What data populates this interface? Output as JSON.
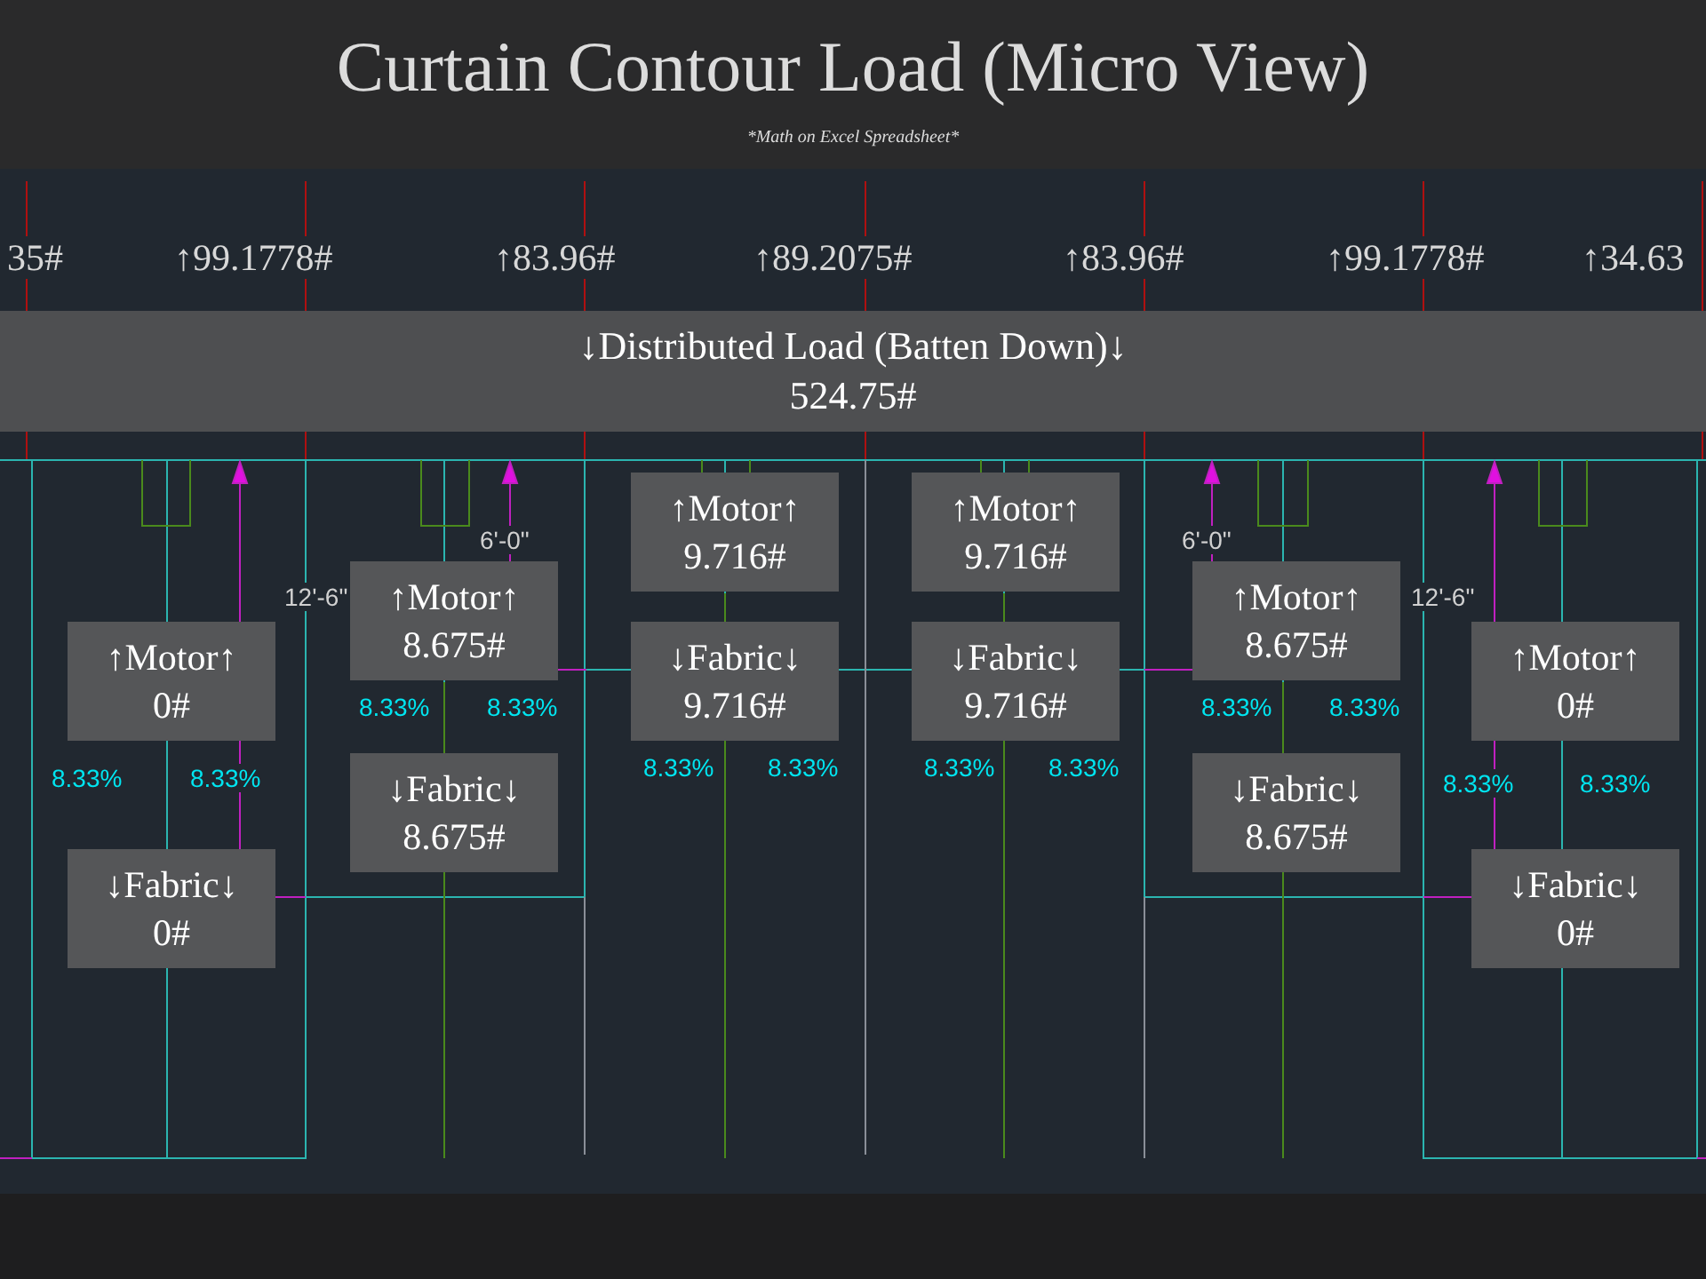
{
  "title": "Curtain Contour Load (Micro View)",
  "subtitle": "*Math on Excel Spreadsheet*",
  "top_loads": [
    "35#",
    "↑99.1778#",
    "↑83.96#",
    "↑89.2075#",
    "↑83.96#",
    "↑99.1778#",
    "↑34.63"
  ],
  "distributed_load": {
    "label": "↓Distributed Load (Batten Down)↓",
    "value": "524.75#"
  },
  "sections": [
    {
      "motor": {
        "label": "↑Motor↑",
        "value": "0#"
      },
      "fabric": {
        "label": "↓Fabric↓",
        "value": "0#"
      },
      "dimension": "12'-6\"",
      "percentages": [
        "8.33%",
        "8.33%"
      ]
    },
    {
      "motor": {
        "label": "↑Motor↑",
        "value": "8.675#"
      },
      "fabric": {
        "label": "↓Fabric↓",
        "value": "8.675#"
      },
      "dimension": "6'-0\"",
      "percentages": [
        "8.33%",
        "8.33%"
      ]
    },
    {
      "motor": {
        "label": "↑Motor↑",
        "value": "9.716#"
      },
      "fabric": {
        "label": "↓Fabric↓",
        "value": "9.716#"
      },
      "percentages": [
        "8.33%",
        "8.33%"
      ]
    },
    {
      "motor": {
        "label": "↑Motor↑",
        "value": "9.716#"
      },
      "fabric": {
        "label": "↓Fabric↓",
        "value": "9.716#"
      },
      "percentages": [
        "8.33%",
        "8.33%"
      ]
    },
    {
      "motor": {
        "label": "↑Motor↑",
        "value": "8.675#"
      },
      "fabric": {
        "label": "↓Fabric↓",
        "value": "8.675#"
      },
      "dimension": "6'-0\"",
      "percentages": [
        "8.33%",
        "8.33%"
      ]
    },
    {
      "motor": {
        "label": "↑Motor↑",
        "value": "0#"
      },
      "fabric": {
        "label": "↓Fabric↓",
        "value": "0#"
      },
      "dimension": "12'-6\"",
      "percentages": [
        "8.33%",
        "8.33%"
      ]
    }
  ]
}
